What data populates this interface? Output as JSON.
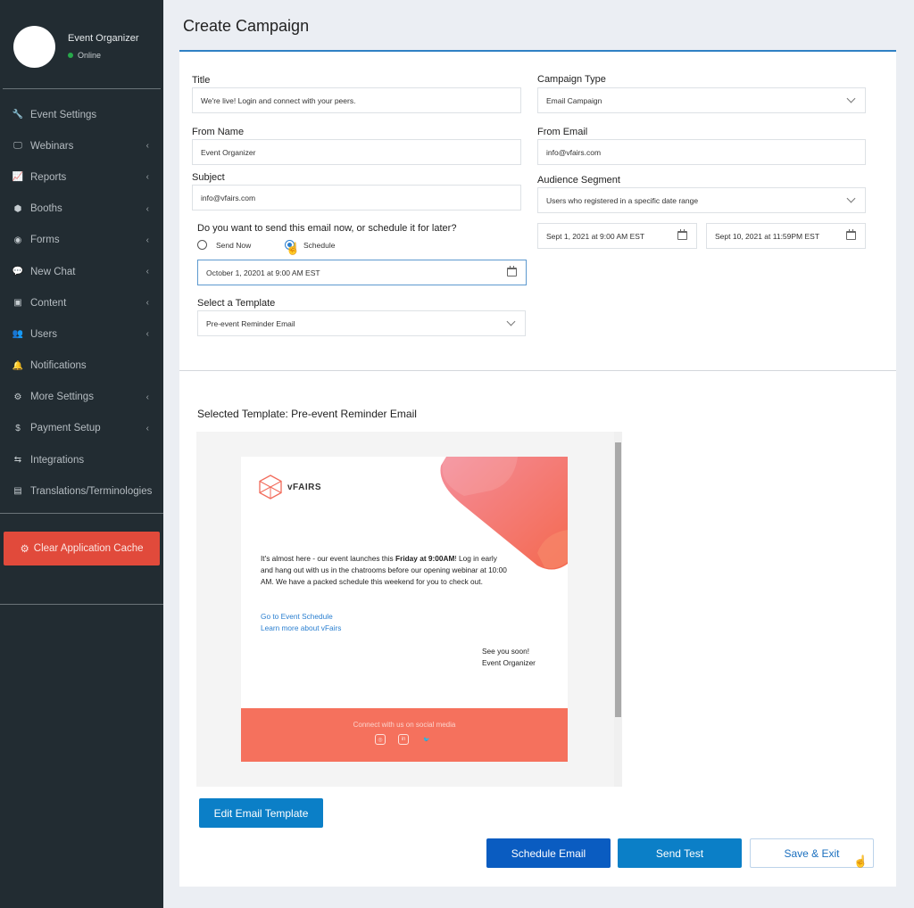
{
  "sidebar": {
    "profile": {
      "name": "Event Organizer",
      "status": "Online"
    },
    "items": [
      {
        "label": "Event Settings",
        "icon": "wrench-icon",
        "glyph": "🔧",
        "has_submenu": false
      },
      {
        "label": "Webinars",
        "icon": "monitor-icon",
        "glyph": "🖵",
        "has_submenu": true
      },
      {
        "label": "Reports",
        "icon": "line-chart-icon",
        "glyph": "📈",
        "has_submenu": true
      },
      {
        "label": "Booths",
        "icon": "cube-icon",
        "glyph": "⬢",
        "has_submenu": true
      },
      {
        "label": "Forms",
        "icon": "dot-circle-icon",
        "glyph": "◉",
        "has_submenu": true
      },
      {
        "label": "New Chat",
        "icon": "comments-icon",
        "glyph": "💬",
        "has_submenu": true
      },
      {
        "label": "Content",
        "icon": "image-icon",
        "glyph": "▣",
        "has_submenu": true
      },
      {
        "label": "Users",
        "icon": "users-icon",
        "glyph": "👥",
        "has_submenu": true
      },
      {
        "label": "Notifications",
        "icon": "bell-icon",
        "glyph": "🔔",
        "has_submenu": false
      },
      {
        "label": "More Settings",
        "icon": "gear-icon",
        "glyph": "⚙",
        "has_submenu": true
      },
      {
        "label": "Payment Setup",
        "icon": "dollar-icon",
        "glyph": "$",
        "has_submenu": true
      },
      {
        "label": "Integrations",
        "icon": "usb-icon",
        "glyph": "⇆",
        "has_submenu": false
      },
      {
        "label": "Translations/Terminologies",
        "icon": "translate-icon",
        "glyph": "▤",
        "has_submenu": false
      }
    ],
    "chevron": "‹",
    "clear_cache_label": "Clear Application Cache",
    "clear_cache_icon": "⚙"
  },
  "page": {
    "title": "Create Campaign"
  },
  "form": {
    "title": {
      "label": "Title",
      "value": "We're live! Login and connect with your peers."
    },
    "from_name": {
      "label": "From Name",
      "value": "Event Organizer"
    },
    "subject": {
      "label": "Subject",
      "value": "info@vfairs.com"
    },
    "campaign_type": {
      "label": "Campaign Type",
      "value": "Email Campaign"
    },
    "from_email": {
      "label": "From Email",
      "value": "info@vfairs.com"
    },
    "audience_segment": {
      "label": "Audience Segment",
      "value": "Users who registered in a specific date range"
    },
    "date_range": {
      "start": "Sept 1, 2021 at 9:00 AM EST",
      "end": "Sept 10, 2021 at 11:59PM EST"
    },
    "send_question": "Do you want to send this email now, or schedule it for later?",
    "send_options": [
      {
        "label": "Send Now",
        "selected": false
      },
      {
        "label": "Schedule",
        "selected": true
      }
    ],
    "schedule_date": "October 1, 20201 at 9:00 AM EST",
    "template": {
      "label": "Select a Template",
      "value": "Pre-event Reminder Email"
    }
  },
  "preview": {
    "heading": "Selected Template: Pre-event Reminder Email",
    "brand": "vFAIRS",
    "body_before": "It's almost here - our event launches this ",
    "body_bold": "Friday at 9:00AM",
    "body_after": "! Log in early and hang out with us in the chatrooms before our opening webinar at 10:00 AM. We have a packed schedule this weekend for you to check out.",
    "links": [
      "Go to Event Schedule",
      "Learn more about vFairs"
    ],
    "signoff": [
      "See you soon!",
      "Event Organizer"
    ],
    "footer_text": "Connect with us on social media",
    "social": [
      {
        "name": "instagram-icon",
        "glyph": "◎"
      },
      {
        "name": "linkedin-icon",
        "glyph": "in"
      },
      {
        "name": "twitter-icon",
        "glyph": "🐦"
      }
    ],
    "colors": {
      "accent": "#f5715d",
      "link": "#2a7fd0"
    }
  },
  "actions": {
    "edit_template": "Edit Email Template",
    "schedule_email": "Schedule Email",
    "send_test": "Send Test",
    "save_exit": "Save & Exit"
  },
  "colors": {
    "sidebar_bg": "#222c32",
    "primary": "#0b7fc7",
    "primary_dark": "#0a5cc1",
    "danger": "#e14a3b",
    "online": "#27a84a"
  }
}
